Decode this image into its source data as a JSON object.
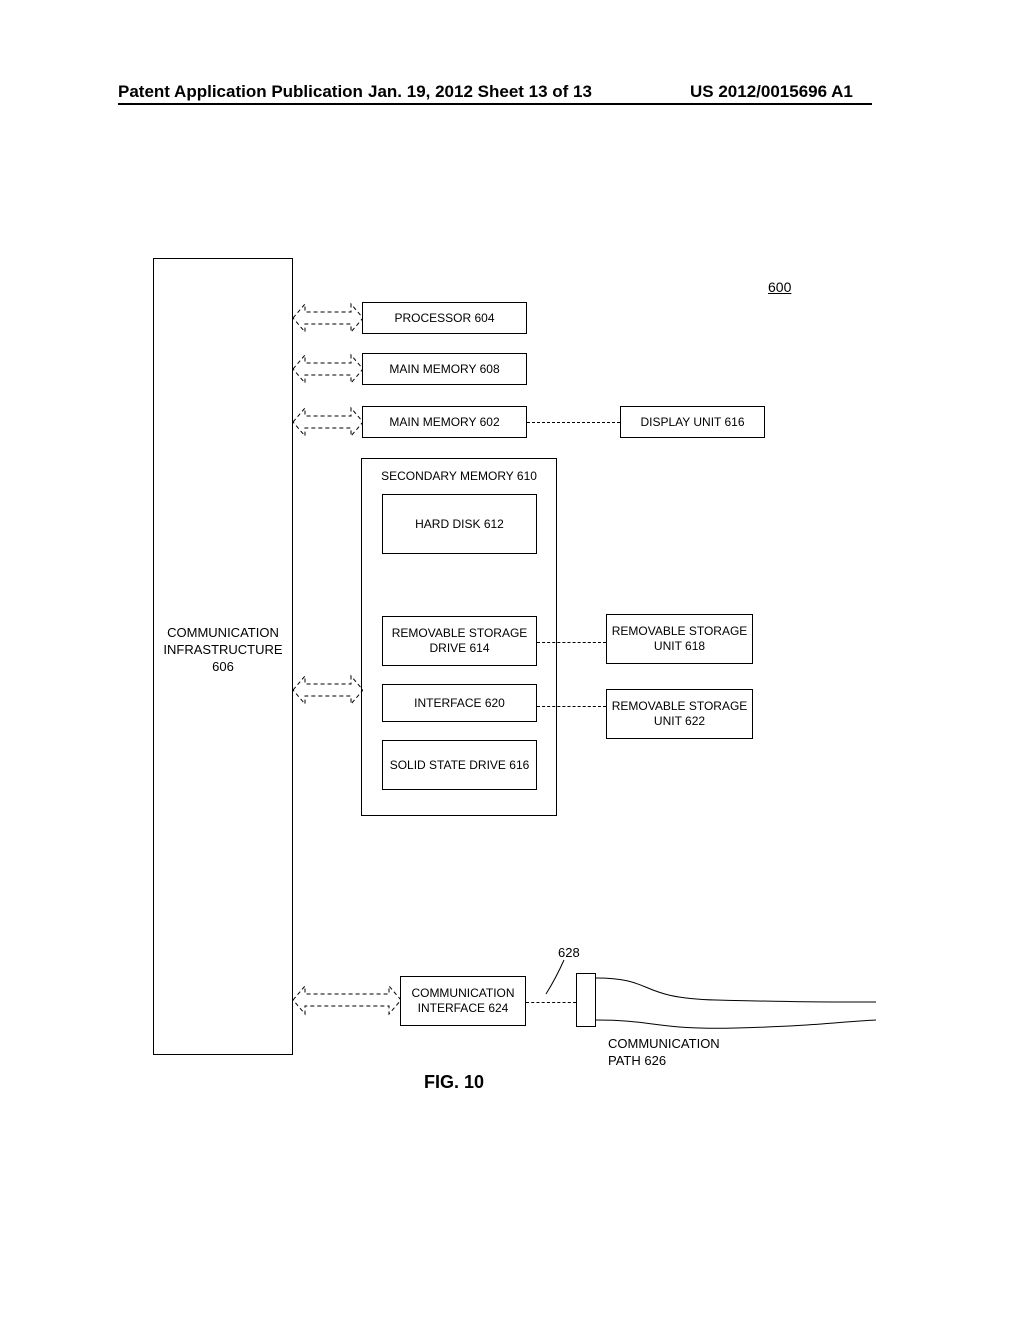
{
  "header": {
    "left": "Patent Application Publication",
    "center": "Jan. 19, 2012   Sheet 13 of 13",
    "pubno": "US 2012/0015696 A1"
  },
  "sysref": "600",
  "blocks": {
    "processor": "PROCESSOR 604",
    "mainmem608": "MAIN MEMORY 608",
    "mainmem602": "MAIN MEMORY 602",
    "display": "DISPLAY UNIT 616",
    "secmem_title": "SECONDARY MEMORY 610",
    "harddisk": "HARD DISK 612",
    "rsd": "REMOVABLE STORAGE DRIVE 614",
    "rsu618": "REMOVABLE STORAGE UNIT 618",
    "iface620": "INTERFACE 620",
    "rsu622": "REMOVABLE STORAGE UNIT 622",
    "ssd": "SOLID STATE DRIVE 616",
    "commif": "COMMUNICATION INTERFACE 624"
  },
  "labels": {
    "comm_infra1": "COMMUNICATION",
    "comm_infra2": "INFRASTRUCTURE",
    "comm_infra3": "606",
    "ref628": "628",
    "comm_path1": "COMMUNICATION",
    "comm_path2": "PATH 626"
  },
  "figure": "FIG. 10"
}
